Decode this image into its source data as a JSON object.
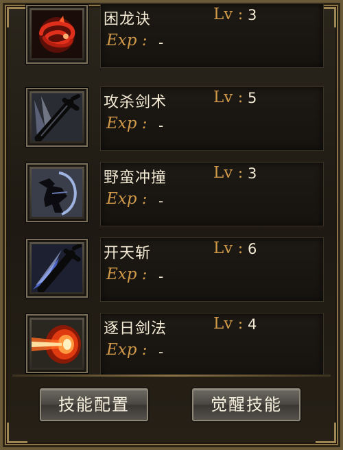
{
  "skills": [
    {
      "name": "困龙诀",
      "lv_label": "Lv :",
      "level": "3",
      "exp_label": "Exp :",
      "exp": "-",
      "icon": "red-dragon-icon"
    },
    {
      "name": "攻杀剑术",
      "lv_label": "Lv :",
      "level": "5",
      "exp_label": "Exp :",
      "exp": "-",
      "icon": "sword-strike-icon"
    },
    {
      "name": "野蛮冲撞",
      "lv_label": "Lv :",
      "level": "3",
      "exp_label": "Exp :",
      "exp": "-",
      "icon": "charging-warrior-icon"
    },
    {
      "name": "开天斩",
      "lv_label": "Lv :",
      "level": "6",
      "exp_label": "Exp :",
      "exp": "-",
      "icon": "blue-slash-sword-icon"
    },
    {
      "name": "逐日剑法",
      "lv_label": "Lv :",
      "level": "4",
      "exp_label": "Exp :",
      "exp": "-",
      "icon": "fire-wave-icon"
    }
  ],
  "buttons": {
    "config": "技能配置",
    "awaken": "觉醒技能"
  },
  "colors": {
    "label_gold": "#d19a4a",
    "text_light": "#f2ead4",
    "frame_gold": "#8c7547"
  }
}
